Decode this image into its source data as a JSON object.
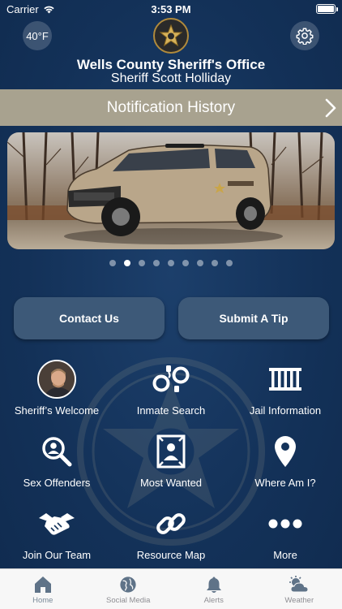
{
  "status_bar": {
    "carrier": "Carrier",
    "time": "3:53 PM"
  },
  "header": {
    "temperature": "40°F",
    "title": "Wells County Sheriff's Office",
    "subtitle": "Sheriff Scott Holliday"
  },
  "notification_bar": {
    "label": "Notification History"
  },
  "carousel": {
    "page_count": 9,
    "active_index": 1
  },
  "buttons": {
    "contact": "Contact Us",
    "tip": "Submit A Tip"
  },
  "grid": [
    {
      "label": "Sheriff’s Welcome",
      "icon": "sheriff-avatar"
    },
    {
      "label": "Inmate Search",
      "icon": "handcuffs-icon"
    },
    {
      "label": "Jail Information",
      "icon": "jail-bars-icon"
    },
    {
      "label": "Sex Offenders",
      "icon": "magnify-person-icon"
    },
    {
      "label": "Most Wanted",
      "icon": "wanted-poster-icon"
    },
    {
      "label": "Where Am I?",
      "icon": "location-pin-icon"
    },
    {
      "label": "Join Our Team",
      "icon": "handshake-icon"
    },
    {
      "label": "Resource Map",
      "icon": "link-icon"
    },
    {
      "label": "More",
      "icon": "more-dots-icon"
    }
  ],
  "tabbar": [
    {
      "label": "Home",
      "icon": "home-icon"
    },
    {
      "label": "Social Media",
      "icon": "globe-icon"
    },
    {
      "label": "Alerts",
      "icon": "bell-icon"
    },
    {
      "label": "Weather",
      "icon": "weather-icon"
    }
  ],
  "colors": {
    "navy": "#14335a",
    "notif_bar": "#a8a28f",
    "button": "#3d5978",
    "tab_icon": "#5f7388"
  }
}
